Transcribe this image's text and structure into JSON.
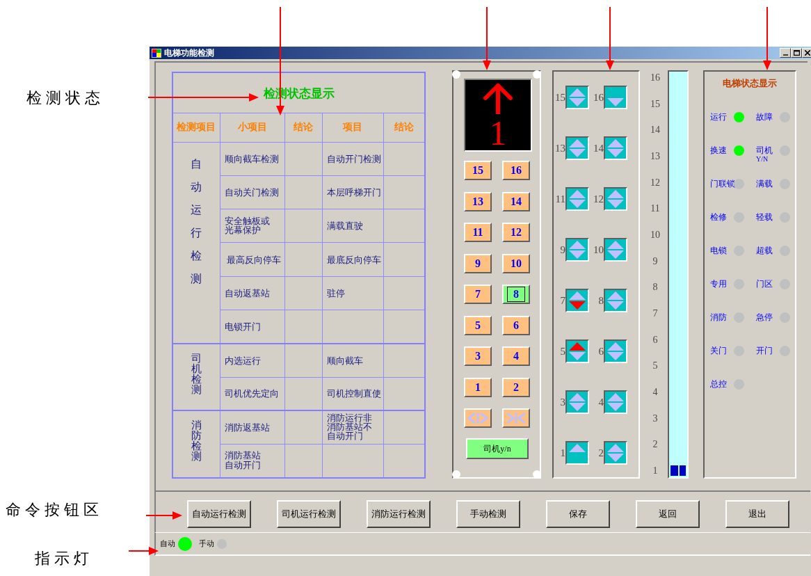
{
  "annotations": [
    {
      "text": "检 测 状 态"
    },
    {
      "text": "命 令 按 钮 区"
    },
    {
      "text": "指 示 灯"
    }
  ],
  "window": {
    "title": "电梯功能检测"
  },
  "check_table": {
    "title": "检测状态显示",
    "columns": [
      "检测项目",
      "小项目",
      "结论",
      "项目",
      "结论"
    ],
    "groups": [
      {
        "name": "自动运行检测",
        "rows": [
          {
            "item": "顺向截车检测",
            "item_2": "自动开门检测"
          },
          {
            "item": "自动关门检测",
            "item_2": "本层呼梯开门"
          },
          {
            "item": "安全触板或光幕保护",
            "item_2": "满载直驶"
          },
          {
            "item": " 最高反向停车",
            "item_2": "最底反向停车"
          },
          {
            "item": "自动返基站",
            "item_2": "驻停"
          },
          {
            "item": "电锁开门"
          }
        ]
      },
      {
        "name": "司机检测",
        "rows": [
          {
            "item": "内选运行",
            "item_2": "顺向截车"
          },
          {
            "item": "司机优先定向",
            "item_2": "司机控制直使"
          }
        ]
      },
      {
        "name": "消防检测",
        "rows": [
          {
            "item": "消防返基站",
            "item_2": "消防运行非消防基站不自动开门"
          },
          {
            "item": "消防基站自动开门"
          }
        ]
      }
    ]
  },
  "car_panel": {
    "display": {
      "up": true,
      "floor": "1"
    },
    "buttons": [
      {
        "label": "15",
        "selected": false
      },
      {
        "label": "16",
        "selected": false
      },
      {
        "label": "13",
        "selected": false
      },
      {
        "label": "14",
        "selected": false
      },
      {
        "label": "11",
        "selected": false
      },
      {
        "label": "12",
        "selected": false
      },
      {
        "label": "9",
        "selected": false
      },
      {
        "label": "10",
        "selected": false
      },
      {
        "label": "7",
        "selected": false
      },
      {
        "label": "8",
        "selected": true
      },
      {
        "label": "5",
        "selected": false
      },
      {
        "label": "6",
        "selected": false
      },
      {
        "label": "3",
        "selected": false
      },
      {
        "label": "4",
        "selected": false
      },
      {
        "label": "1",
        "selected": false
      },
      {
        "label": "2",
        "selected": false
      }
    ],
    "door_buttons": [
      {
        "kind": "open",
        "disabled": true
      },
      {
        "kind": "close",
        "disabled": true
      }
    ],
    "driver_button": {
      "label": "司机y/n",
      "on": true
    }
  },
  "hall_calls": [
    {
      "floor": "15",
      "up": false,
      "down": false
    },
    {
      "floor": "16",
      "down": false
    },
    {
      "floor": "13",
      "up": false,
      "down": false
    },
    {
      "floor": "14",
      "up": false,
      "down": false
    },
    {
      "floor": "11",
      "up": false,
      "down": false
    },
    {
      "floor": "12",
      "up": false,
      "down": false
    },
    {
      "floor": "9",
      "up": false,
      "down": false
    },
    {
      "floor": "10",
      "up": false,
      "down": false
    },
    {
      "floor": "7",
      "up": false,
      "down": true
    },
    {
      "floor": "8",
      "up": false,
      "down": false
    },
    {
      "floor": "5",
      "up": true,
      "down": false
    },
    {
      "floor": "6",
      "up": false,
      "down": false
    },
    {
      "floor": "3",
      "up": false,
      "down": false
    },
    {
      "floor": "4",
      "up": false,
      "down": false
    },
    {
      "floor": "1",
      "up": false
    },
    {
      "floor": "2",
      "up": false,
      "down": false
    }
  ],
  "shaft": {
    "floors": [
      "16",
      "15",
      "14",
      "13",
      "12",
      "11",
      "10",
      "9",
      "8",
      "7",
      "6",
      "5",
      "4",
      "3",
      "2",
      "1"
    ]
  },
  "status_panel": {
    "title": "电梯状态显示",
    "lamps": [
      {
        "label": "运行",
        "on": true
      },
      {
        "label": "故障",
        "on": false
      },
      {
        "label": "换速",
        "on": true
      },
      {
        "label": "司机",
        "sublabel": "Y/N",
        "on": false
      },
      {
        "label": "门联锁",
        "on": false
      },
      {
        "label": "满载",
        "on": false
      },
      {
        "label": "检修",
        "on": false
      },
      {
        "label": "轻载",
        "on": false
      },
      {
        "label": "电锁",
        "on": false
      },
      {
        "label": "超载",
        "on": false
      },
      {
        "label": "专用",
        "on": false
      },
      {
        "label": "门区",
        "on": false
      },
      {
        "label": "消防",
        "on": false
      },
      {
        "label": "急停",
        "on": false
      },
      {
        "label": "关门",
        "on": false
      },
      {
        "label": "开门",
        "on": false
      },
      {
        "label": "总控",
        "on": false
      }
    ]
  },
  "commands": [
    "自动运行检测",
    "司机运行检测",
    "消防运行检测",
    "手动检测",
    "保存",
    "返回",
    "退出"
  ],
  "mode_indicators": [
    {
      "label": "自动",
      "on": true
    },
    {
      "label": "手动",
      "on": false
    }
  ]
}
